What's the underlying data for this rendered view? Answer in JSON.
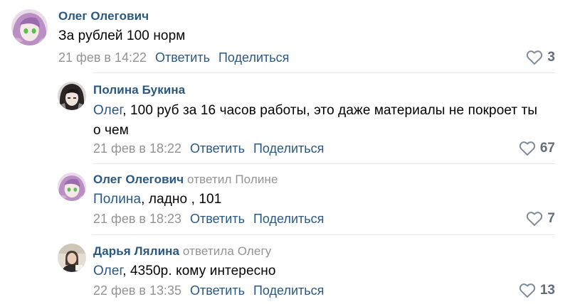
{
  "comments": [
    {
      "author": "Олег Олегович",
      "reply_to": "",
      "mention": "",
      "text": "За рублей 100 норм",
      "date": "21 фев в 14:22",
      "reply_label": "Ответить",
      "share_label": "Поделиться",
      "likes": "3"
    },
    {
      "author": "Полина Букина",
      "reply_to": "",
      "mention": "Олег",
      "text": ", 100 руб за 16 часов работы, это даже материалы не покроет ты о чем",
      "date": "21 фев в 18:22",
      "reply_label": "Ответить",
      "share_label": "Поделиться",
      "likes": "67"
    },
    {
      "author": "Олег Олегович",
      "reply_to": "ответил Полине",
      "mention": "Полина",
      "text": ", ладно , 101",
      "date": "21 фев в 18:23",
      "reply_label": "Ответить",
      "share_label": "Поделиться",
      "likes": "7"
    },
    {
      "author": "Дарья Лялина",
      "reply_to": "ответила Олегу",
      "mention": "Олег",
      "text": ", 4350р. кому интересно",
      "date": "22 фев в 13:35",
      "reply_label": "Ответить",
      "share_label": "Поделиться",
      "likes": "13"
    }
  ],
  "colors": {
    "link": "#2a5885",
    "secondary": "#939393",
    "likes": "#626d7a",
    "divider": "#e7e8ec"
  },
  "icons": {
    "like": "heart-icon",
    "avatar": "user-avatar-image"
  }
}
